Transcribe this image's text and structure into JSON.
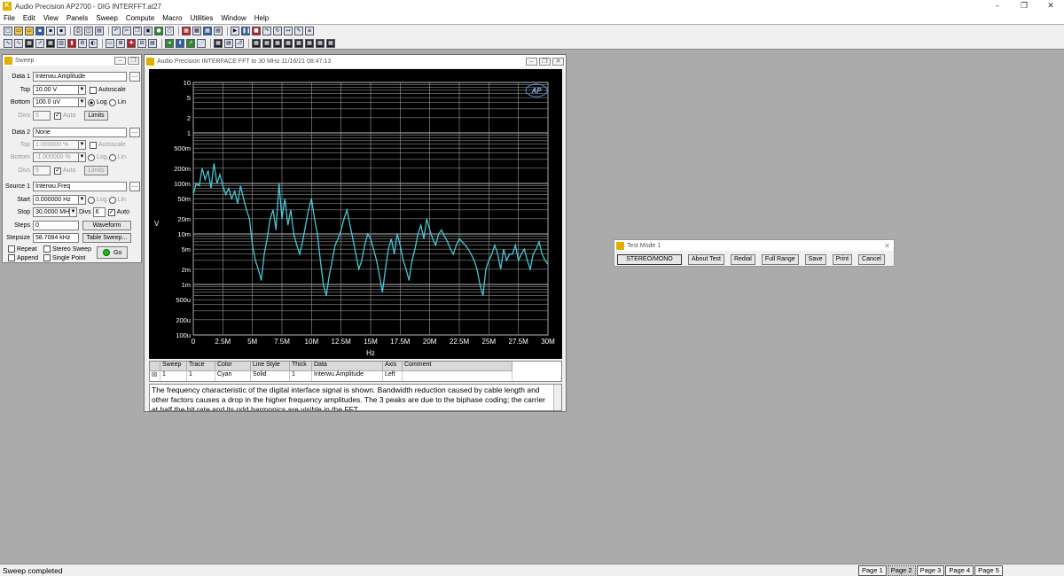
{
  "window": {
    "title": "Audio Precision AP2700 - DIG INTERFFT.at27",
    "controls": [
      "–",
      "❐",
      "✕"
    ]
  },
  "menu": [
    "File",
    "Edit",
    "View",
    "Panels",
    "Sweep",
    "Compute",
    "Macro",
    "Utilities",
    "Window",
    "Help"
  ],
  "sweep_panel": {
    "title": "Sweep",
    "data1": {
      "label": "Data 1",
      "value": "Interwu.Amplitude"
    },
    "top": {
      "label": "Top",
      "value": "10.00 V",
      "autoscale": "Autoscale"
    },
    "bottom": {
      "label": "Bottom",
      "value": "100.0 uV",
      "log": "Log",
      "lin": "Lin"
    },
    "div": {
      "label": "Divs",
      "value": "5",
      "auto": "Auto",
      "limits": "Limits"
    },
    "data2": {
      "label": "Data 2",
      "value": "None"
    },
    "top2": {
      "label": "Top",
      "value": "1.000000 %",
      "autoscale": "Autoscale"
    },
    "bottom2": {
      "label": "Bottom",
      "value": "-1.000000 %",
      "log": "Log",
      "lin": "Lin"
    },
    "div2": {
      "label": "Divs",
      "value": "5",
      "auto": "Auto",
      "limits": "Limits"
    },
    "source1": {
      "label": "Source 1",
      "value": "Interwu.Freq"
    },
    "start": {
      "label": "Start",
      "value": "0.000000 Hz",
      "log": "Log",
      "lin": "Lin"
    },
    "stop": {
      "label": "Stop",
      "value": "30.0000 MHz",
      "divs_label": "Divs",
      "divs": "6",
      "auto": "Auto"
    },
    "steps": {
      "label": "Steps",
      "value": "0",
      "waveform": "Waveform"
    },
    "stepsize": {
      "label": "Stepsize",
      "value": "58.7084 kHz",
      "table": "Table Sweep..."
    },
    "repeat": "Repeat",
    "stereo": "Stereo Sweep",
    "append": "Append",
    "single": "Single Point",
    "go": "Go"
  },
  "graph_window": {
    "title": "Audio Precision  INTERFACE FFT to 30 MHz    11/16/21 08:47:13",
    "ylabel": "V",
    "xlabel": "Hz",
    "logo": "AP",
    "table": {
      "headers": [
        "Sweep",
        "Trace",
        "Color",
        "Line Style",
        "Thick",
        "Data",
        "Axis",
        "Comment"
      ],
      "row": [
        "1",
        "1",
        "Cyan",
        "Solid",
        "1",
        "Interwu.Amplitude",
        "Left",
        ""
      ]
    },
    "description": "The frequency characteristic of the digital interface signal is shown.  Bandwidth reduction caused by cable length and other factors causes a drop in the higher frequency amplitudes.  The 3 peaks are due to the biphase coding; the carrier at half the bit rate and its odd harmonics are visible in the FFT."
  },
  "chart_data": {
    "type": "line",
    "title": "",
    "xlabel": "Hz",
    "ylabel": "V",
    "xlim": [
      0,
      30000000
    ],
    "ylim": [
      0.0001,
      10
    ],
    "yscale": "log",
    "grid": true,
    "x_ticks": [
      "0",
      "2.5M",
      "5M",
      "7.5M",
      "10M",
      "12.5M",
      "15M",
      "17.5M",
      "20M",
      "22.5M",
      "25M",
      "27.5M",
      "30M"
    ],
    "y_ticks": [
      "100u",
      "200u",
      "500u",
      "1m",
      "2m",
      "5m",
      "10m",
      "20m",
      "50m",
      "100m",
      "200m",
      "500m",
      "1",
      "2",
      "5",
      "10"
    ],
    "color": "#46c6d4",
    "series": [
      {
        "name": "",
        "x": [
          0,
          250000,
          500000,
          750000,
          1000000,
          1250000,
          1500000,
          1750000,
          2000000,
          2250000,
          2500000,
          2750000,
          3000000,
          3250000,
          3500000,
          3750000,
          4000000,
          4250000,
          4500000,
          4750000,
          5000000,
          5250000,
          5500000,
          5750000,
          6000000,
          6250000,
          6500000,
          6750000,
          7000000,
          7250000,
          7500000,
          7750000,
          8000000,
          8250000,
          8500000,
          8750000,
          9000000,
          9250000,
          9500000,
          9750000,
          10000000,
          10250000,
          10500000,
          10750000,
          11000000,
          11250000,
          11500000,
          11750000,
          12000000,
          12250000,
          12500000,
          12750000,
          13000000,
          13250000,
          13500000,
          13750000,
          14000000,
          14250000,
          14500000,
          14750000,
          15000000,
          15250000,
          15500000,
          15750000,
          16000000,
          16250000,
          16500000,
          16750000,
          17000000,
          17250000,
          17500000,
          17750000,
          18000000,
          18250000,
          18500000,
          18750000,
          19000000,
          19250000,
          19500000,
          19750000,
          20000000,
          20250000,
          20500000,
          20750000,
          21000000,
          21250000,
          21500000,
          21750000,
          22000000,
          22250000,
          22500000,
          22750000,
          23000000,
          23250000,
          23500000,
          23750000,
          24000000,
          24250000,
          24500000,
          24750000,
          25000000,
          25250000,
          25500000,
          25750000,
          26000000,
          26250000,
          26500000,
          26750000,
          27000000,
          27250000,
          27500000,
          27750000,
          28000000,
          28250000,
          28500000,
          28750000,
          29000000,
          29250000,
          29500000,
          29750000,
          30000000
        ],
        "values": [
          0.06,
          0.1,
          0.09,
          0.2,
          0.12,
          0.18,
          0.08,
          0.25,
          0.1,
          0.15,
          0.09,
          0.06,
          0.08,
          0.05,
          0.07,
          0.04,
          0.09,
          0.05,
          0.03,
          0.02,
          0.006,
          0.003,
          0.002,
          0.0012,
          0.004,
          0.008,
          0.02,
          0.03,
          0.012,
          0.1,
          0.02,
          0.05,
          0.015,
          0.03,
          0.01,
          0.006,
          0.004,
          0.007,
          0.015,
          0.03,
          0.05,
          0.02,
          0.01,
          0.003,
          0.001,
          0.0006,
          0.0015,
          0.003,
          0.006,
          0.008,
          0.012,
          0.02,
          0.03,
          0.015,
          0.008,
          0.004,
          0.002,
          0.003,
          0.006,
          0.01,
          0.008,
          0.005,
          0.003,
          0.0015,
          0.0007,
          0.002,
          0.005,
          0.008,
          0.004,
          0.01,
          0.006,
          0.003,
          0.002,
          0.0012,
          0.003,
          0.005,
          0.01,
          0.015,
          0.008,
          0.02,
          0.012,
          0.008,
          0.006,
          0.01,
          0.012,
          0.009,
          0.007,
          0.005,
          0.004,
          0.006,
          0.008,
          0.007,
          0.006,
          0.005,
          0.004,
          0.003,
          0.002,
          0.001,
          0.0006,
          0.002,
          0.003,
          0.004,
          0.006,
          0.004,
          0.002,
          0.005,
          0.003,
          0.004,
          0.004,
          0.006,
          0.003,
          0.004,
          0.005,
          0.003,
          0.002,
          0.004,
          0.005,
          0.007,
          0.004,
          0.003,
          0.0025
        ]
      }
    ]
  },
  "test_panel": {
    "title": "Test Mode 1",
    "close": "✕",
    "buttons": [
      "STEREO/MONO",
      "About Test",
      "Redial",
      "Full Range",
      "Save",
      "Print",
      "Cancel"
    ]
  },
  "status": {
    "text": "Sweep completed",
    "pages": [
      "Page 1",
      "Page 2",
      "Page 3",
      "Page 4",
      "Page 5"
    ],
    "active_page": 1
  }
}
